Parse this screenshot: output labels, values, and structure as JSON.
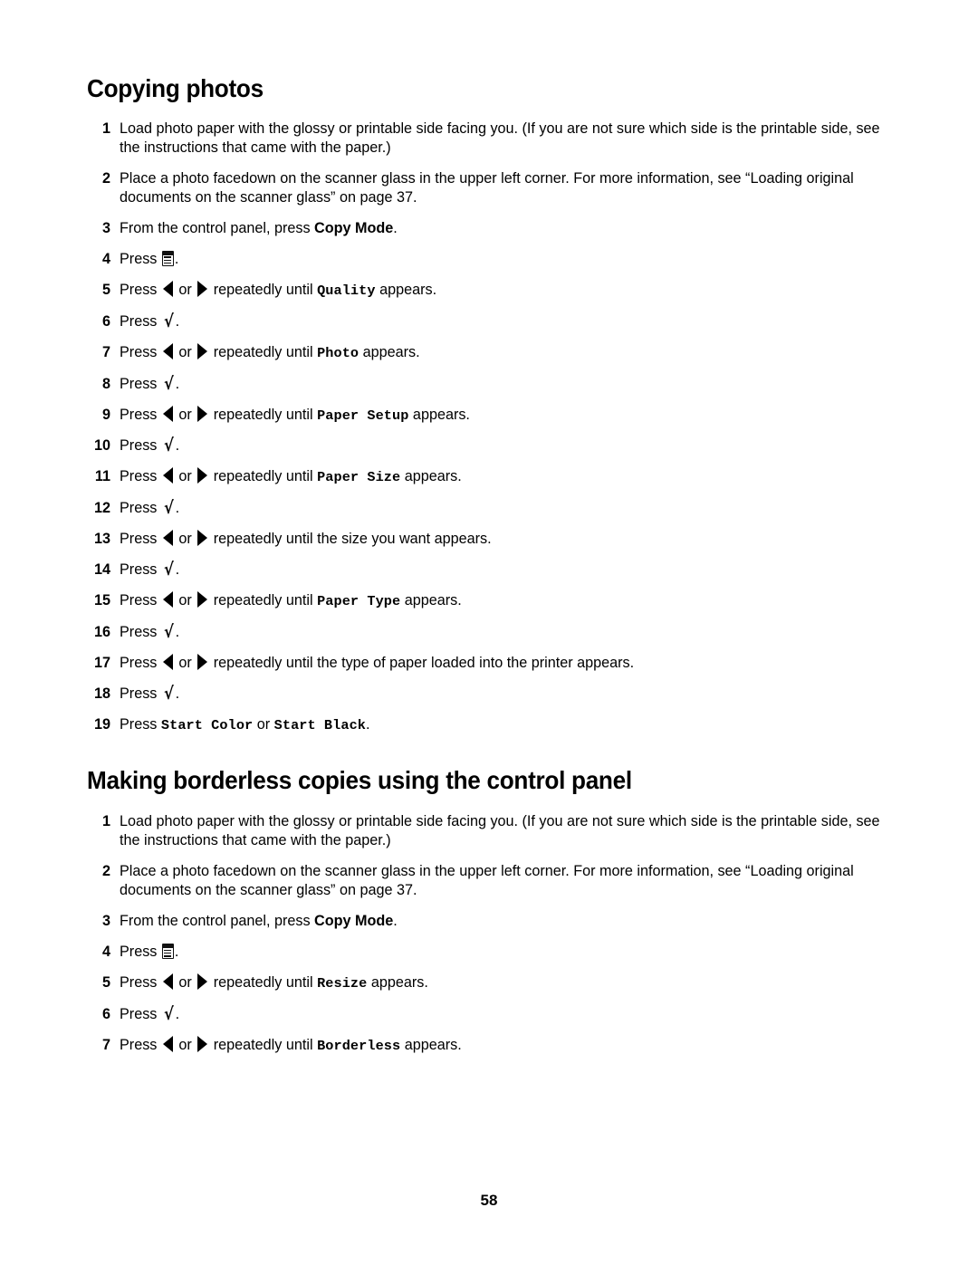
{
  "page": {
    "number": "58"
  },
  "icons": {
    "menu": "menu-icon",
    "left_arrow": "left-arrow-icon",
    "right_arrow": "right-arrow-icon",
    "check": "checkmark-icon",
    "check_glyph": "√"
  },
  "common": {
    "press": "Press",
    "or": "or",
    "repeatedly_until": "repeatedly until",
    "appears": "appears.",
    "period": ".",
    "from_control_panel_prefix": "From the control panel, press ",
    "copy_mode": "Copy Mode",
    "load_photo_paper": "Load photo paper with the glossy or printable side facing you. (If you are not sure which side is the printable side, see the instructions that came with the paper.)",
    "place_photo_facedown": "Place a photo facedown on the scanner glass in the upper left corner. For more information, see “Loading original documents on the scanner glass” on page 37."
  },
  "sections": [
    {
      "id": "copying-photos",
      "heading": "Copying photos",
      "steps": [
        {
          "n": "1",
          "kind": "plain",
          "text": "Load photo paper with the glossy or printable side facing you. (If you are not sure which side is the printable side, see the instructions that came with the paper.)"
        },
        {
          "n": "2",
          "kind": "plain",
          "text": "Place a photo facedown on the scanner glass in the upper left corner. For more information, see “Loading original documents on the scanner glass” on page 37."
        },
        {
          "n": "3",
          "kind": "copymode",
          "prefix": "From the control panel, press ",
          "bold": "Copy Mode",
          "suffix": "."
        },
        {
          "n": "4",
          "kind": "menu",
          "prefix": "Press ",
          "suffix": "."
        },
        {
          "n": "5",
          "kind": "arrows-lcd",
          "prefix": "Press ",
          "mid": "repeatedly until ",
          "lcd": "Quality",
          "suffix": " appears."
        },
        {
          "n": "6",
          "kind": "check",
          "prefix": "Press ",
          "suffix": "."
        },
        {
          "n": "7",
          "kind": "arrows-lcd",
          "prefix": "Press ",
          "mid": "repeatedly until ",
          "lcd": "Photo",
          "suffix": " appears."
        },
        {
          "n": "8",
          "kind": "check",
          "prefix": "Press ",
          "suffix": "."
        },
        {
          "n": "9",
          "kind": "arrows-lcd",
          "prefix": "Press ",
          "mid": "repeatedly until ",
          "lcd": "Paper Setup",
          "suffix": " appears."
        },
        {
          "n": "10",
          "kind": "check",
          "prefix": "Press ",
          "suffix": "."
        },
        {
          "n": "11",
          "kind": "arrows-lcd",
          "prefix": "Press ",
          "mid": "repeatedly until ",
          "lcd": "Paper Size",
          "suffix": " appears."
        },
        {
          "n": "12",
          "kind": "check",
          "prefix": "Press ",
          "suffix": "."
        },
        {
          "n": "13",
          "kind": "arrows-text",
          "prefix": "Press ",
          "mid": "repeatedly until the size you want appears."
        },
        {
          "n": "14",
          "kind": "check",
          "prefix": "Press ",
          "suffix": "."
        },
        {
          "n": "15",
          "kind": "arrows-lcd",
          "prefix": "Press ",
          "mid": "repeatedly until ",
          "lcd": "Paper Type",
          "suffix": " appears."
        },
        {
          "n": "16",
          "kind": "check",
          "prefix": "Press ",
          "suffix": "."
        },
        {
          "n": "17",
          "kind": "arrows-text",
          "prefix": "Press ",
          "mid": "repeatedly until the type of paper loaded into the printer appears."
        },
        {
          "n": "18",
          "kind": "check",
          "prefix": "Press ",
          "suffix": "."
        },
        {
          "n": "19",
          "kind": "start",
          "prefix": "Press ",
          "lcd1": "Start Color",
          "mid": " or ",
          "lcd2": "Start Black",
          "suffix": "."
        }
      ]
    },
    {
      "id": "making-borderless-copies",
      "heading": "Making borderless copies using the control panel",
      "steps": [
        {
          "n": "1",
          "kind": "plain",
          "text": "Load photo paper with the glossy or printable side facing you. (If you are not sure which side is the printable side, see the instructions that came with the paper.)"
        },
        {
          "n": "2",
          "kind": "plain",
          "text": "Place a photo facedown on the scanner glass in the upper left corner. For more information, see “Loading original documents on the scanner glass” on page 37."
        },
        {
          "n": "3",
          "kind": "copymode",
          "prefix": "From the control panel, press ",
          "bold": "Copy Mode",
          "suffix": "."
        },
        {
          "n": "4",
          "kind": "menu",
          "prefix": "Press ",
          "suffix": "."
        },
        {
          "n": "5",
          "kind": "arrows-lcd",
          "prefix": "Press ",
          "mid": "repeatedly until ",
          "lcd": "Resize",
          "suffix": " appears."
        },
        {
          "n": "6",
          "kind": "check",
          "prefix": "Press ",
          "suffix": "."
        },
        {
          "n": "7",
          "kind": "arrows-lcd",
          "prefix": "Press ",
          "mid": "repeatedly until ",
          "lcd": "Borderless",
          "suffix": " appears."
        }
      ]
    }
  ]
}
